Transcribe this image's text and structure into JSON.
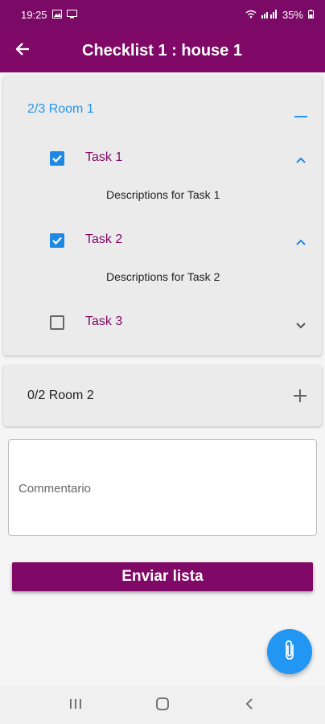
{
  "status_bar": {
    "time": "19:25",
    "battery": "35%"
  },
  "app_bar": {
    "title": "Checklist 1 : house 1"
  },
  "rooms": [
    {
      "header": "2/3 Room 1",
      "expanded": true,
      "tasks": [
        {
          "label": "Task 1",
          "checked": true,
          "expanded": true,
          "description": "Descriptions for Task 1"
        },
        {
          "label": "Task 2",
          "checked": true,
          "expanded": true,
          "description": "Descriptions for Task 2"
        },
        {
          "label": "Task 3",
          "checked": false,
          "expanded": false,
          "description": ""
        }
      ]
    },
    {
      "header": "0/2 Room 2",
      "expanded": false,
      "tasks": []
    }
  ],
  "comment": {
    "placeholder": "Commentario",
    "value": ""
  },
  "submit_button": {
    "label": "Enviar lista"
  },
  "colors": {
    "primary": "#800866",
    "accent": "#1e88e5",
    "fab": "#2196f3"
  },
  "icons": {
    "back": "arrow-left-icon",
    "collapse": "minus-icon",
    "expand": "plus-icon",
    "task_expanded": "chevron-up-icon",
    "task_collapsed": "chevron-down-icon",
    "fab": "paperclip-icon"
  }
}
